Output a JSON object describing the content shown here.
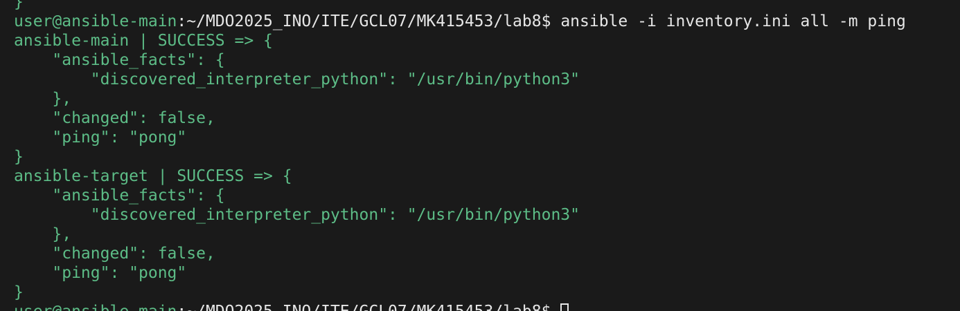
{
  "terminal": {
    "lines": [
      {
        "text": "}"
      },
      {
        "prompt": "user@ansible-main",
        "path": ":~/MDO2025_INO/ITE/GCL07/MK415453/lab8",
        "symbol": "$",
        "command": " ansible -i inventory.ini all -m ping"
      },
      {
        "text": "ansible-main | SUCCESS => {"
      },
      {
        "text": "    \"ansible_facts\": {"
      },
      {
        "text": "        \"discovered_interpreter_python\": \"/usr/bin/python3\""
      },
      {
        "text": "    },"
      },
      {
        "text": "    \"changed\": false,"
      },
      {
        "text": "    \"ping\": \"pong\""
      },
      {
        "text": "}"
      },
      {
        "text": "ansible-target | SUCCESS => {"
      },
      {
        "text": "    \"ansible_facts\": {"
      },
      {
        "text": "        \"discovered_interpreter_python\": \"/usr/bin/python3\""
      },
      {
        "text": "    },"
      },
      {
        "text": "    \"changed\": false,"
      },
      {
        "text": "    \"ping\": \"pong\""
      },
      {
        "text": "}"
      },
      {
        "prompt": "user@ansible-main",
        "path": ":~/MDO2025_INO/ITE/GCL07/MK415453/lab8",
        "symbol": "$",
        "command": " "
      }
    ]
  },
  "colors": {
    "background": "#1a1a1a",
    "output": "#5dbd87",
    "command": "#e6e6e6"
  }
}
